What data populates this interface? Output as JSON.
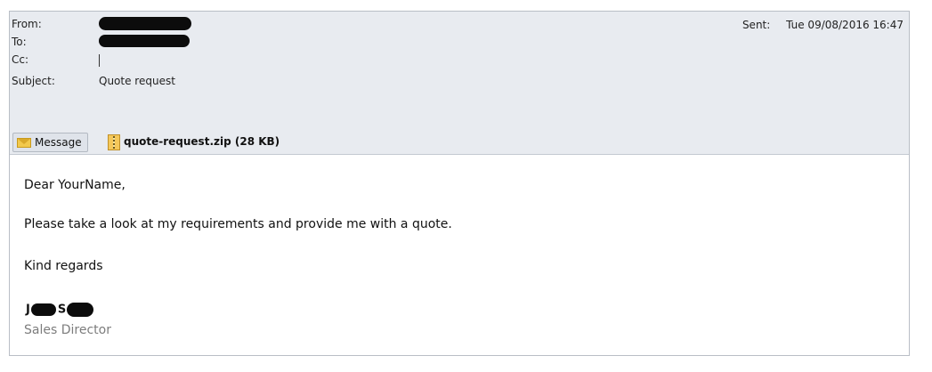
{
  "header": {
    "from_label": "From:",
    "to_label": "To:",
    "cc_label": "Cc:",
    "subject_label": "Subject:",
    "subject_value": "Quote request",
    "sent_label": "Sent:",
    "sent_value": "Tue 09/08/2016 16:47",
    "from_value": "[redacted]",
    "to_value": "[redacted]"
  },
  "tabs": {
    "message_label": "Message",
    "attachment_label": "quote-request.zip (28 KB)",
    "message_icon": "envelope-icon",
    "attachment_icon": "zip-file-icon"
  },
  "body": {
    "greeting": "Dear YourName,",
    "request": "Please take a look at my requirements and provide me with a quote.",
    "closing": "Kind regards",
    "signature_initial_first": "J",
    "signature_initial_last": "S",
    "signature_title": "Sales Director"
  },
  "colors": {
    "header_bg": "#e8ebf0",
    "border": "#b9bec6",
    "title_text": "#7d7d7d",
    "redaction": "#0c0c0c"
  }
}
